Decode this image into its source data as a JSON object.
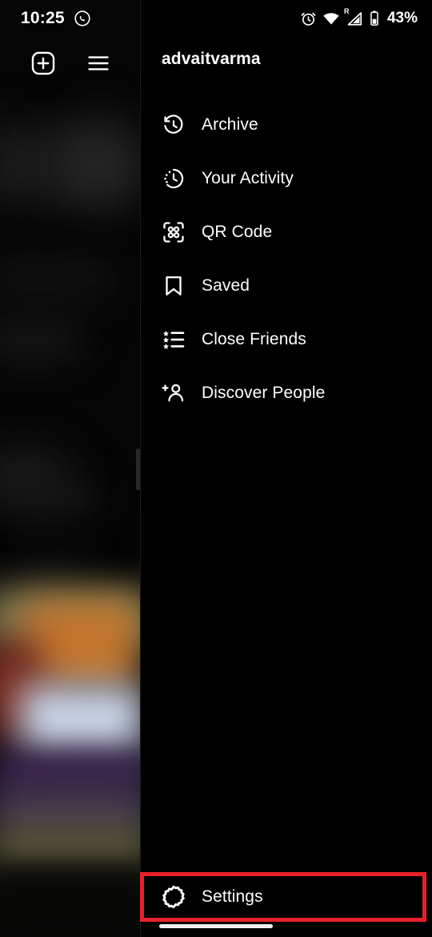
{
  "status_bar": {
    "time": "10:25",
    "battery_percent": "43%",
    "icons": [
      {
        "name": "whatsapp-icon",
        "side": "left"
      },
      {
        "name": "alarm-icon",
        "side": "right"
      },
      {
        "name": "wifi-icon",
        "side": "right"
      },
      {
        "name": "roaming-signal-icon",
        "side": "right",
        "badge": "R"
      },
      {
        "name": "battery-icon",
        "side": "right"
      }
    ]
  },
  "top_actions": {
    "add_label": "new-post",
    "menu_label": "hamburger-menu"
  },
  "drawer": {
    "username": "advaitvarma",
    "items": [
      {
        "label": "Archive",
        "icon": "archive-clock-icon"
      },
      {
        "label": "Your Activity",
        "icon": "activity-clock-icon"
      },
      {
        "label": "QR Code",
        "icon": "qr-code-icon"
      },
      {
        "label": "Saved",
        "icon": "bookmark-icon"
      },
      {
        "label": "Close Friends",
        "icon": "star-list-icon"
      },
      {
        "label": "Discover People",
        "icon": "person-add-icon"
      }
    ],
    "settings": {
      "label": "Settings",
      "icon": "gear-icon",
      "highlighted": true
    }
  },
  "colors": {
    "background": "#000000",
    "text": "#ffffff",
    "highlight": "#e8202a",
    "divider": "#1c1c1c"
  }
}
